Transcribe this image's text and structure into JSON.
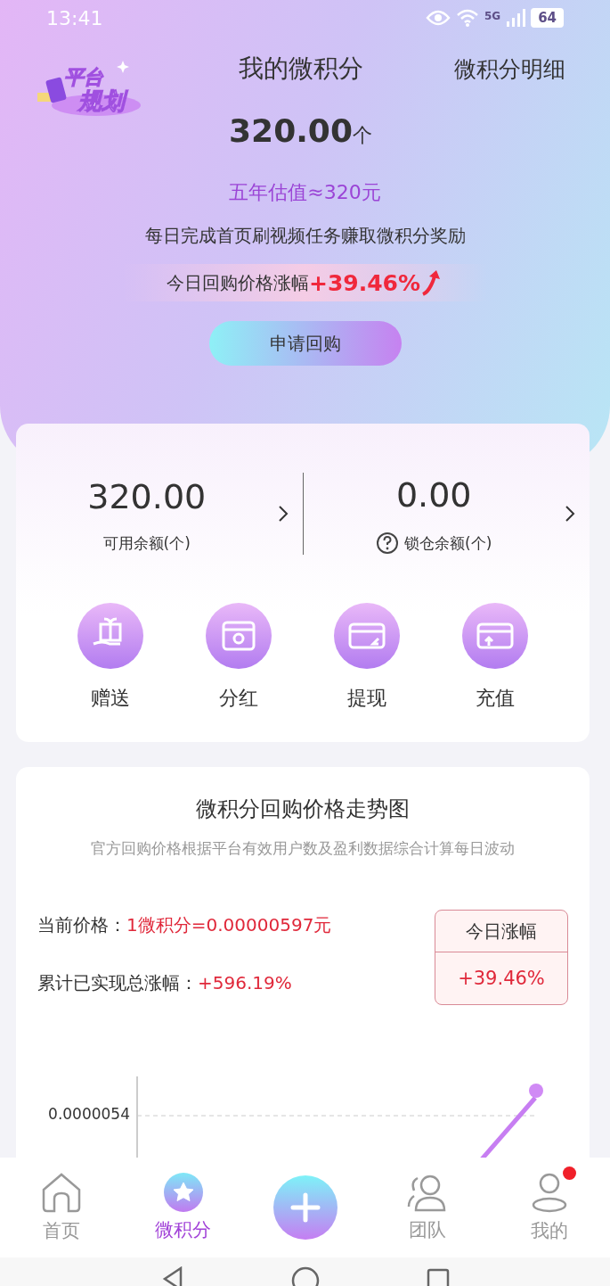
{
  "status_bar": {
    "time": "13:41",
    "network": "5G",
    "battery": "64"
  },
  "header": {
    "logo": {
      "line1": "平台",
      "line2": "规划"
    },
    "title": "我的微积分",
    "link": "微积分明细"
  },
  "amount": {
    "value": "320.00",
    "unit": "个"
  },
  "estimate": "五年估值≈320元",
  "description": "每日完成首页刷视频任务赚取微积分奖励",
  "today_rise": {
    "label": "今日回购价格涨幅",
    "value": "+39.46%"
  },
  "apply_button": "申请回购",
  "balances": [
    {
      "value": "320.00",
      "label": "可用余额",
      "unit": "(个)",
      "help": false
    },
    {
      "value": "0.00",
      "label": "锁仓余额",
      "unit": "(个)",
      "help": true
    }
  ],
  "actions": [
    {
      "label": "赠送",
      "kind": "gift"
    },
    {
      "label": "分红",
      "kind": "dividend"
    },
    {
      "label": "提现",
      "kind": "withdraw"
    },
    {
      "label": "充值",
      "kind": "recharge"
    }
  ],
  "trend": {
    "title": "微积分回购价格走势图",
    "subtitle": "官方回购价格根据平台有效用户数及盈利数据综合计算每日波动",
    "price_label": "当前价格：",
    "price_value": "1微积分=0.00000597元",
    "total_label": "累计已实现总涨幅：",
    "total_value": "+596.19%",
    "today_box": {
      "title": "今日涨幅",
      "value": "+39.46%"
    },
    "y_tick": "0.0000054"
  },
  "tabs": [
    {
      "label": "首页",
      "kind": "home",
      "selected": false,
      "badge": false
    },
    {
      "label": "微积分",
      "kind": "star",
      "selected": true,
      "badge": false
    },
    {
      "kind": "plus",
      "selected": false,
      "badge": false
    },
    {
      "label": "团队",
      "kind": "team",
      "selected": false,
      "badge": false
    },
    {
      "label": "我的",
      "kind": "user",
      "selected": false,
      "badge": true
    }
  ]
}
